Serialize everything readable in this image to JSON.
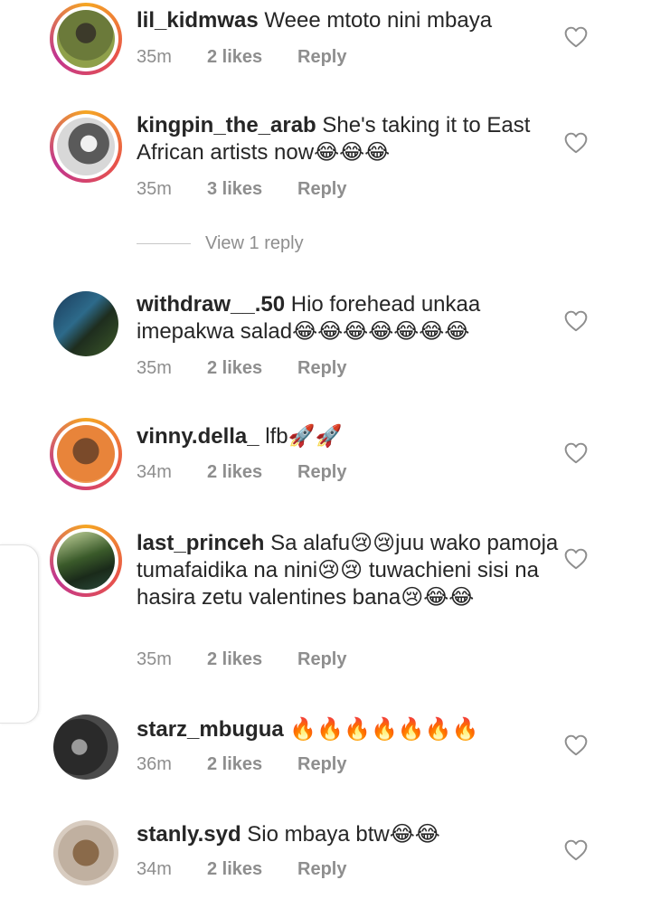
{
  "comments": [
    {
      "username": "lil_kidmwas",
      "text": "Weee mtoto nini mbaya",
      "time": "35m",
      "likes": "2 likes",
      "reply": "Reply",
      "story_ring": true
    },
    {
      "username": "kingpin_the_arab",
      "text": "She's taking it to East African artists now😂😂😂",
      "time": "35m",
      "likes": "3 likes",
      "reply": "Reply",
      "story_ring": true
    },
    {
      "username": "withdraw__.50",
      "text": "Hio forehead unkaa imepakwa salad😂😂😂😂😂😂😂",
      "time": "35m",
      "likes": "2 likes",
      "reply": "Reply",
      "story_ring": false
    },
    {
      "username": "vinny.della_",
      "text": "lfb🚀🚀",
      "time": "34m",
      "likes": "2 likes",
      "reply": "Reply",
      "story_ring": true
    },
    {
      "username": "last_princeh",
      "text": "Sa alafu😢😢juu wako pamoja tumafaidika na nini😢😢 tuwachieni sisi na hasira zetu valentines bana😢😂😂",
      "time": "35m",
      "likes": "2 likes",
      "reply": "Reply",
      "story_ring": true
    },
    {
      "username": "starz_mbugua",
      "text": "🔥🔥🔥🔥🔥🔥🔥",
      "time": "36m",
      "likes": "2 likes",
      "reply": "Reply",
      "story_ring": false
    },
    {
      "username": "stanly.syd",
      "text": "Sio mbaya btw😂😂",
      "time": "34m",
      "likes": "2 likes",
      "reply": "Reply",
      "story_ring": false
    }
  ],
  "view_replies": "View 1 reply",
  "icons": {
    "like": "heart-outline-icon"
  },
  "colors": {
    "primary_text": "#262626",
    "secondary_text": "#8e8e8e",
    "story_ring_start": "#f5a623",
    "story_ring_end": "#c1358f"
  }
}
